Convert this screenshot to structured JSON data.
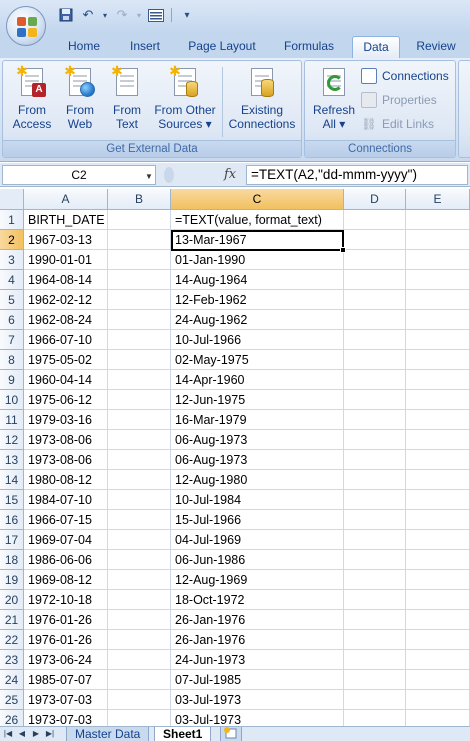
{
  "qat": {
    "undo": "↶",
    "redo": "↷",
    "more": "▾"
  },
  "tabs": [
    {
      "label": "Home"
    },
    {
      "label": "Insert"
    },
    {
      "label": "Page Layout"
    },
    {
      "label": "Formulas"
    },
    {
      "label": "Data"
    },
    {
      "label": "Review"
    }
  ],
  "ribbon": {
    "get_external_data": {
      "label": "Get External Data",
      "from_access": [
        "From",
        "Access"
      ],
      "from_web": [
        "From",
        "Web"
      ],
      "from_text": [
        "From",
        "Text"
      ],
      "from_other": [
        "From Other",
        "Sources ▾"
      ],
      "existing": [
        "Existing",
        "Connections"
      ]
    },
    "connections": {
      "label": "Connections",
      "refresh": [
        "Refresh",
        "All ▾"
      ],
      "connections_btn": "Connections",
      "properties_btn": "Properties",
      "edit_links_btn": "Edit Links"
    }
  },
  "formula_bar": {
    "name_box": "C2",
    "fx": "fx",
    "formula": "=TEXT(A2,\"dd-mmm-yyyy\")"
  },
  "columns": [
    "A",
    "B",
    "C",
    "D",
    "E"
  ],
  "rows": [
    {
      "n": "1",
      "a": "BIRTH_DATE",
      "c": "=TEXT(value, format_text)"
    },
    {
      "n": "2",
      "a": "1967-03-13",
      "c": "13-Mar-1967"
    },
    {
      "n": "3",
      "a": "1990-01-01",
      "c": "01-Jan-1990"
    },
    {
      "n": "4",
      "a": "1964-08-14",
      "c": "14-Aug-1964"
    },
    {
      "n": "5",
      "a": "1962-02-12",
      "c": "12-Feb-1962"
    },
    {
      "n": "6",
      "a": "1962-08-24",
      "c": "24-Aug-1962"
    },
    {
      "n": "7",
      "a": "1966-07-10",
      "c": "10-Jul-1966"
    },
    {
      "n": "8",
      "a": "1975-05-02",
      "c": "02-May-1975"
    },
    {
      "n": "9",
      "a": "1960-04-14",
      "c": "14-Apr-1960"
    },
    {
      "n": "10",
      "a": "1975-06-12",
      "c": "12-Jun-1975"
    },
    {
      "n": "11",
      "a": "1979-03-16",
      "c": "16-Mar-1979"
    },
    {
      "n": "12",
      "a": "1973-08-06",
      "c": "06-Aug-1973"
    },
    {
      "n": "13",
      "a": "1973-08-06",
      "c": "06-Aug-1973"
    },
    {
      "n": "14",
      "a": "1980-08-12",
      "c": "12-Aug-1980"
    },
    {
      "n": "15",
      "a": "1984-07-10",
      "c": "10-Jul-1984"
    },
    {
      "n": "16",
      "a": "1966-07-15",
      "c": "15-Jul-1966"
    },
    {
      "n": "17",
      "a": "1969-07-04",
      "c": "04-Jul-1969"
    },
    {
      "n": "18",
      "a": "1986-06-06",
      "c": "06-Jun-1986"
    },
    {
      "n": "19",
      "a": "1969-08-12",
      "c": "12-Aug-1969"
    },
    {
      "n": "20",
      "a": "1972-10-18",
      "c": "18-Oct-1972"
    },
    {
      "n": "21",
      "a": "1976-01-26",
      "c": "26-Jan-1976"
    },
    {
      "n": "22",
      "a": "1976-01-26",
      "c": "26-Jan-1976"
    },
    {
      "n": "23",
      "a": "1973-06-24",
      "c": "24-Jun-1973"
    },
    {
      "n": "24",
      "a": "1985-07-07",
      "c": "07-Jul-1985"
    },
    {
      "n": "25",
      "a": "1973-07-03",
      "c": "03-Jul-1973"
    },
    {
      "n": "26",
      "a": "1973-07-03",
      "c": "03-Jul-1973"
    }
  ],
  "sheets": [
    {
      "label": "Master Data"
    },
    {
      "label": "Sheet1"
    }
  ],
  "colors": {
    "accent": "#15428b",
    "selected_header": "#f1c15f"
  }
}
